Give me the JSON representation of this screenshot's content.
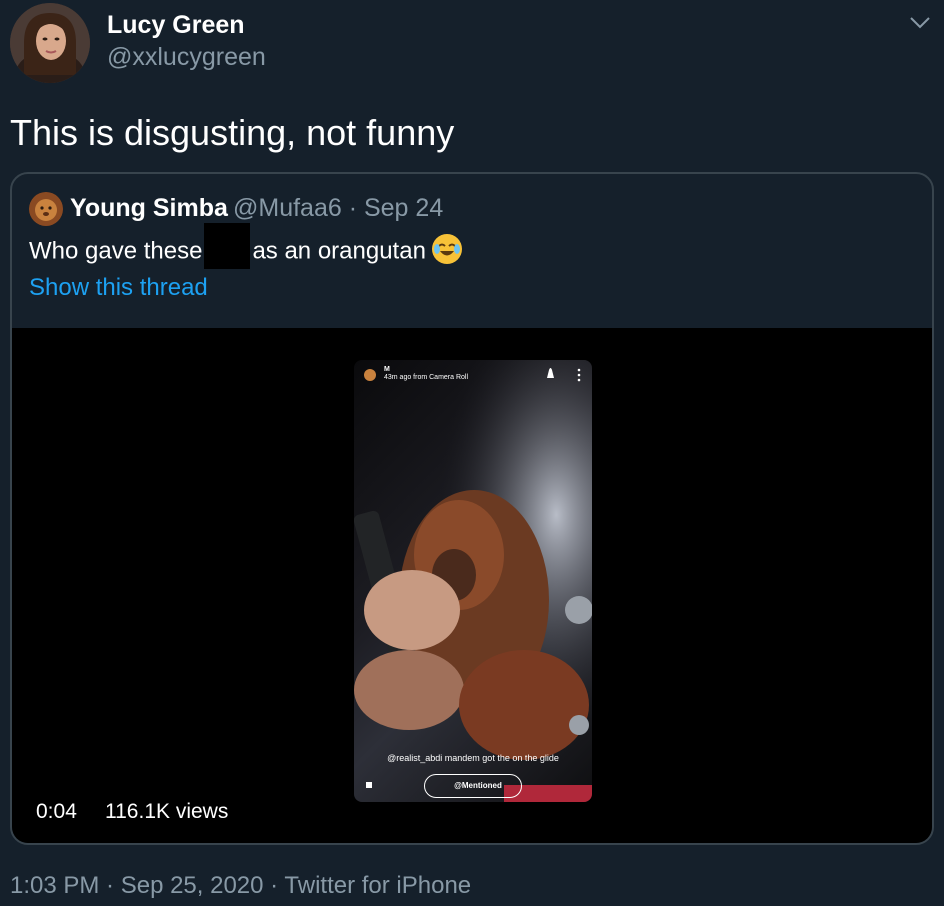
{
  "author": {
    "name": "Lucy Green",
    "handle": "@xxlucygreen"
  },
  "tweet": {
    "text": "This is disgusting, not funny"
  },
  "quoted": {
    "name": "Young Simba",
    "meta": "@Mufaa6 · Sep 24",
    "text_before": "Who gave these",
    "text_after": "as an orangutan",
    "show_thread": "Show this thread",
    "video": {
      "snap_user": "M",
      "snap_subtitle": "43m ago from Camera Roll",
      "caption": "@realist_abdi mandem got the on the glide",
      "mention_pill": "@Mentioned",
      "time": "0:04",
      "views": "116.1K views"
    }
  },
  "footer": {
    "meta": "1:03 PM · Sep 25, 2020 · Twitter for iPhone"
  },
  "icons": {
    "caret": "chevron-down-icon",
    "emoji": "face-with-tears-of-joy-icon"
  },
  "colors": {
    "background": "#15202b",
    "secondary_text": "#8899a6",
    "link": "#1da1f2",
    "border": "#38444d"
  }
}
